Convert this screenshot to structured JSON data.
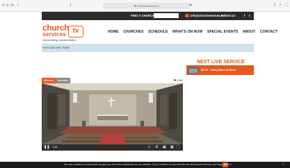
{
  "browser": {
    "url": "churchservices.tv",
    "back_icon": "chevron-left-icon",
    "forward_icon": "chevron-right-icon"
  },
  "topbar": {
    "find_label": "FIND A CHURCH",
    "find_placeholder": "",
    "email": "info@churchservices.tv",
    "follow_label": "Follow Us:",
    "facebook": "f",
    "twitter": "t"
  },
  "logo": {
    "word1": "church",
    "word2": "services",
    "tv": "tv",
    "tagline": "Connecting Communities"
  },
  "nav": {
    "items": [
      "HOME",
      "CHURCHES",
      "SCHEDULE",
      "WHAT'S ON NOW",
      "SPECIAL EVENTS",
      "ABOUT",
      "CONTACT"
    ]
  },
  "strip": {
    "text": "ever and ever. Amen."
  },
  "video": {
    "tabs": [
      "Church",
      "Sermon"
    ],
    "live_label": "LIVE",
    "time": "1:05",
    "accent": "#e8581d"
  },
  "next_service": {
    "title": "NEXT LIVE SERVICE",
    "item": "09:30 - Daily Mass at Noon"
  },
  "cookie": {
    "text": "We use cookies to ensure that we give you the best experience on our website. If you continue to use this site we will assume that you are happy with it.",
    "ok": "Ok"
  }
}
